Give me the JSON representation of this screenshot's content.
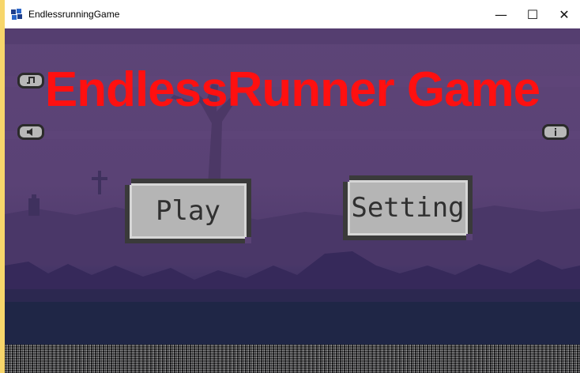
{
  "window": {
    "title": "EndlessrunningGame",
    "controls": {
      "minimize": "—",
      "maximize": "☐",
      "close": "✕"
    }
  },
  "game": {
    "title": "EndlessRunner Game",
    "buttons": {
      "play": "Play",
      "setting": "Setting"
    },
    "icons": {
      "music": "music-note-icon",
      "sound": "speaker-icon",
      "info": "info-icon"
    }
  }
}
